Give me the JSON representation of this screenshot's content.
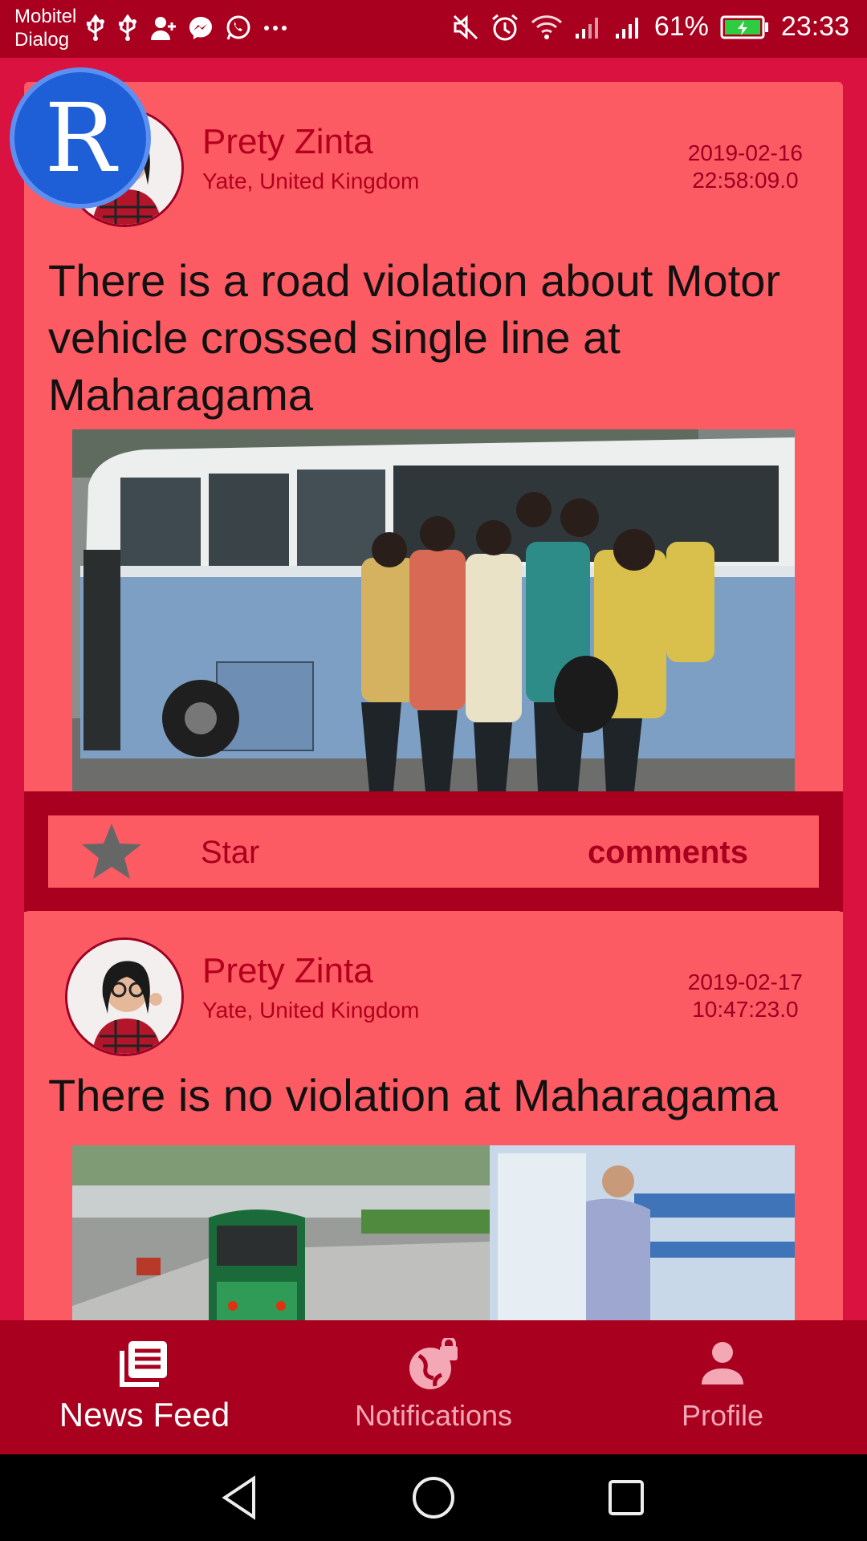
{
  "status_bar": {
    "carrier_1": "Mobitel",
    "carrier_2": "Dialog",
    "battery": "61%",
    "time": "23:33",
    "icons_left": [
      "usb-icon",
      "usb-icon",
      "add-user-icon",
      "messenger-icon",
      "whatsapp-icon",
      "more-dots-icon"
    ],
    "icons_right": [
      "mute-icon",
      "alarm-icon",
      "wifi-icon",
      "signal-icon",
      "signal-icon",
      "battery-charging-icon"
    ]
  },
  "badge": {
    "letter": "R"
  },
  "posts": [
    {
      "user_name": "Prety Zinta",
      "location": "Yate, United Kingdom",
      "date": "2019-02-16",
      "time": "22:58:09.0",
      "title": "There is a road violation about Motor vehicle crossed single line at Maharagama",
      "star_label": "Star",
      "comments_label": "comments"
    },
    {
      "user_name": "Prety Zinta",
      "location": "Yate, United Kingdom",
      "date": "2019-02-17",
      "time": "10:47:23.0",
      "title": "There is no violation at Maharagama"
    }
  ],
  "bottom_nav": {
    "items": [
      {
        "label": "News Feed",
        "icon": "newspaper-icon",
        "active": true
      },
      {
        "label": "Notifications",
        "icon": "globe-lock-icon",
        "active": false
      },
      {
        "label": "Profile",
        "icon": "person-icon",
        "active": false
      }
    ]
  },
  "colors": {
    "primary_dark": "#a8001e",
    "card": "#fc5b63",
    "background": "#d9123f",
    "text_dark_red": "#b3001c"
  }
}
